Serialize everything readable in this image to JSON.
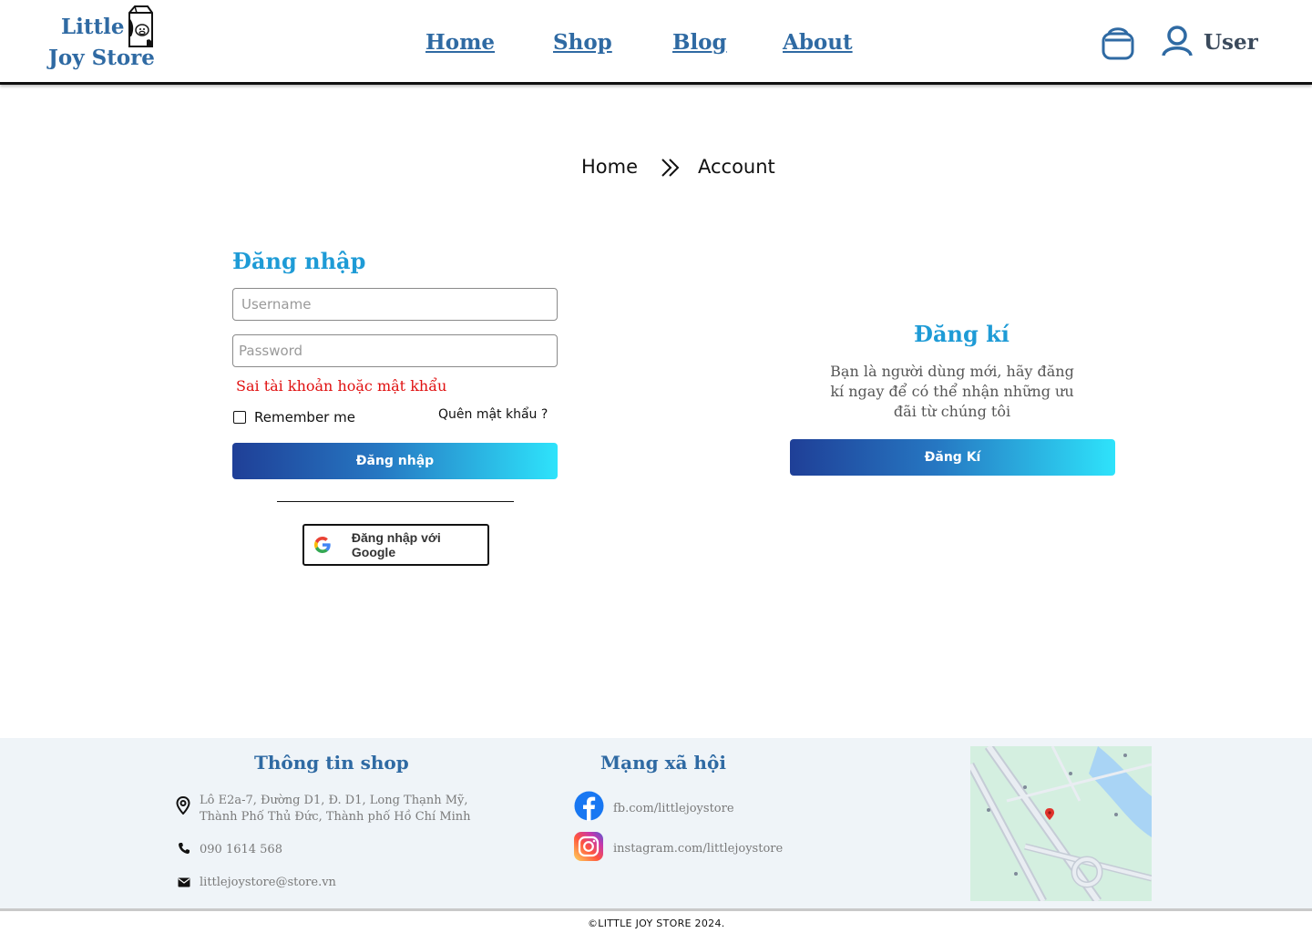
{
  "header": {
    "logo_line1": "Little",
    "logo_line2": "Joy Store",
    "nav": [
      "Home",
      "Shop",
      "Blog",
      "About"
    ],
    "user_label": "User"
  },
  "breadcrumb": {
    "home": "Home",
    "current": "Account"
  },
  "login": {
    "title": "Đăng nhập",
    "username_placeholder": "Username",
    "password_placeholder": "Password",
    "error": "Sai tài khoản hoặc mật khẩu",
    "remember": "Remember me",
    "forgot": "Quên mật khẩu ?",
    "submit": "Đăng nhập",
    "google": "Đăng nhập với Google"
  },
  "register": {
    "title": "Đăng kí",
    "description": "Bạn là người dùng mới, hãy đăng kí ngay để có thể nhận những ưu đãi từ chúng tôi",
    "button": "Đăng Kí"
  },
  "footer": {
    "shop_title": "Thông tin shop",
    "address_line1": "Lô E2a-7, Đường D1, Đ. D1, Long Thạnh Mỹ,",
    "address_line2": "Thành Phố Thủ Đức, Thành phố Hồ Chí Minh",
    "phone": "090 1614 568",
    "email": "littlejoystore@store.vn",
    "social_title": "Mạng xã hội",
    "facebook": "fb.com/littlejoystore",
    "instagram": "instagram.com/littlejoystore",
    "copyright": "©LITTLE JOY STORE 2024."
  },
  "colors": {
    "brand_blue": "#2f6aa3",
    "accent_blue": "#1e9bd6",
    "error_red": "#e01010",
    "footer_bg": "#eff4f8"
  },
  "icons": [
    "milk-carton-logo-icon",
    "cart-icon",
    "user-icon",
    "double-chevron-right-icon",
    "google-icon",
    "location-pin-icon",
    "phone-icon",
    "mail-icon",
    "facebook-icon",
    "instagram-icon",
    "map-image"
  ]
}
